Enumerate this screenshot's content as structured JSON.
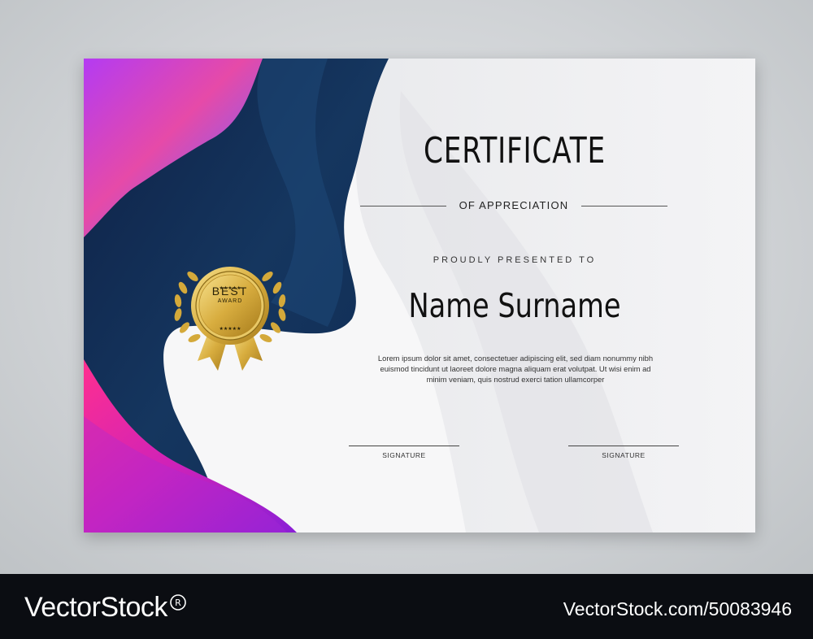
{
  "certificate": {
    "title": "CERTIFICATE",
    "subtitle": "OF APPRECIATION",
    "presented_text": "PROUDLY PRESENTED TO",
    "recipient": "Name Surname",
    "body_lines": [
      "Lorem ipsum dolor sit amet, consectetuer adipiscing elit, sed diam nonummy nibh",
      "euismod tincidunt ut laoreet dolore magna aliquam erat volutpat. Ut wisi enim ad",
      "minim veniam, quis nostrud exerci tation ullamcorper"
    ],
    "signature_labels": [
      "SIGNATURE",
      "SIGNATURE"
    ],
    "medal": {
      "line1": "BEST",
      "line2": "AWARD",
      "stars": "★★★★★"
    }
  },
  "colors": {
    "navy": "#12305a",
    "magenta": "#e0208a",
    "purple": "#a12cf0",
    "blue": "#4a8cf5",
    "gold": "#d4a93a"
  },
  "footer": {
    "brand": "VectorStock",
    "stock_id": "VectorStock.com/50083946",
    "brand_icon": "registered-mark-icon"
  }
}
